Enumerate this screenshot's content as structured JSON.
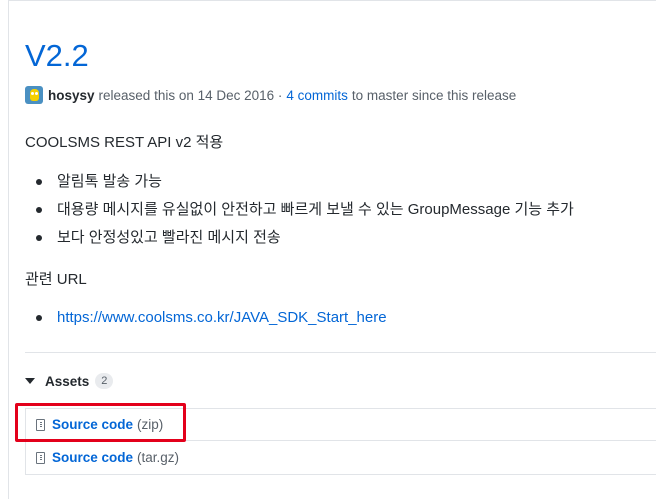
{
  "release": {
    "title": "V2.2",
    "author": "hosysy",
    "released_text": "released this on 14 Dec 2016 ·",
    "commits_link": "4 commits",
    "commits_suffix": "to master since this release"
  },
  "notes": {
    "heading": "COOLSMS REST API v2 적용",
    "bullets": [
      "알림톡 발송 가능",
      "대용량 메시지를 유실없이 안전하고 빠르게 보낼 수 있는 GroupMessage 기능 추가",
      "보다 안정성있고 빨라진 메시지 전송"
    ],
    "related_heading": "관련 URL",
    "related_link": "https://www.coolsms.co.kr/JAVA_SDK_Start_here"
  },
  "assets": {
    "label": "Assets",
    "count": "2",
    "items": [
      {
        "name": "Source code",
        "ext": "(zip)",
        "icon": "file-zip-icon"
      },
      {
        "name": "Source code",
        "ext": "(tar.gz)",
        "icon": "file-zip-icon"
      }
    ]
  },
  "colors": {
    "link": "#0366d6",
    "highlight": "#e3001b"
  }
}
